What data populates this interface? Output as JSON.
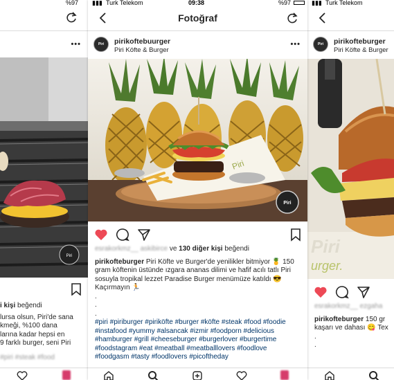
{
  "status_bar": {
    "carrier": "Turk Telekom",
    "time": "09:38",
    "battery": "%97"
  },
  "nav": {
    "title": "Fotoğraf"
  },
  "post": {
    "username": "pirikoftebuurger",
    "subtitle": "Piri Köfte & Burger",
    "avatar_text": "Piri",
    "likes_blurred": "esrakorkmz__ askibirce",
    "likes_mid": "ve",
    "likes_count": "130 diğer kişi",
    "likes_suffix": "beğendi",
    "caption_user": "pirikofteburger",
    "caption_text": "Piri Köfte ve Burger'de yenilikler bitmiyor 🍍 150 gram köftenin üstünde ızgara ananas dilimi ve hafif acılı tatlı Piri sosuyla tropikal lezzet Paradise Burger menümüze katıldı 😎 Kaçırmayın 🏃",
    "dots": [
      ".",
      ".",
      "."
    ],
    "hashtags": "#piri #piriburger #piriköfte #burger #köfte #steak #food #foodie #instafood #yummy #alsancak #izmir #foodporn #delicious #hamburger #grill #cheeseburger #burgerlover #burgertime #foodstagram #eat #meatball #meatballlovers #foodlove #foodgasm #tasty #foodlovers #picoftheday",
    "image_badge": "Piri"
  },
  "left_panel": {
    "likes_suffix": "kişi beğendi",
    "caption_lines": [
      "lursa olsun, Piri'de sana",
      "kmeği, %100 dana",
      "larına kadar hepsi en",
      "9 farklı burger, seni Piri"
    ],
    "tags_fragment": "#piri #steak #food"
  },
  "right_panel": {
    "username": "pirikofteburger",
    "subtitle": "Piri Köfte & Burger",
    "likes_blurred": "esrakorkmz__ ezgaha",
    "caption_user": "pirikofteburger",
    "caption_text1": "150 gr",
    "caption_line2": "kaşarı ve dahası 😋 Tex",
    "dots": [
      ".",
      "."
    ],
    "bg_text_1": "Piri",
    "bg_text_2": "urger."
  },
  "colors": {
    "heart_red": "#ed4956",
    "hashtag": "#003569",
    "divider": "#dbdbdb"
  },
  "icons": {
    "back": "chevron-left-icon",
    "refresh": "refresh-icon",
    "more": "more-dots-icon",
    "like": "heart-filled-icon",
    "comment": "comment-icon",
    "share": "paper-plane-icon",
    "save": "bookmark-icon",
    "home": "home-icon",
    "search": "search-icon",
    "add": "add-post-icon",
    "activity": "heart-outline-icon",
    "profile": "profile-icon"
  }
}
